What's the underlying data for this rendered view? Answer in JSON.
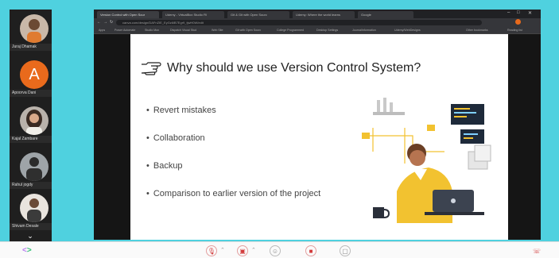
{
  "participants": [
    {
      "name": "Juraj Dhamak",
      "initial": ""
    },
    {
      "name": "Apoorva Dani",
      "initial": "A"
    },
    {
      "name": "Kajal Zambare",
      "initial": ""
    },
    {
      "name": "Rahul jogdy",
      "initial": ""
    },
    {
      "name": "Shivam Desale",
      "initial": ""
    }
  ],
  "browser": {
    "tabs": [
      "Version Control with Open Sour",
      "Udemy - VirtualBox Studio Fil",
      "Git & Git with Open Sourc",
      "Udemy: Where the world learns",
      "Google"
    ],
    "address": "canva.com/design/DAFnZIE_EyGz6iB7Egr9_tjwH0W/edit",
    "bookmarks": [
      "Apps",
      "Power Automate",
      "Studio Mon",
      "Dispatch Visual Stud",
      "Web Site",
      "Git with Open Sourc",
      "College Programmed",
      "Desktop Settings",
      "JournalInformation",
      "Udemy/WebDesigns",
      "Other bookmarks",
      "Reading list"
    ]
  },
  "slide": {
    "title": "Why should we use Version Control System?",
    "bullets": [
      "Revert mistakes",
      "Collaboration",
      "Backup",
      "Comparison to earlier version of the project"
    ]
  },
  "colors": {
    "frame": "#4fd1df",
    "sidebar": "#1f1f1f",
    "avatar_orange": "#e96a1c",
    "shirt_yellow": "#f2c230",
    "end_call_red": "#d23b3b"
  },
  "icons": {
    "pointing_hand": "pointing-hand-icon",
    "mic": "mic-muted-icon",
    "camera": "camera-muted-icon",
    "emoji": "emoji-icon",
    "record": "record-icon",
    "share": "screen-share-icon",
    "end_call": "end-call-icon",
    "code_pager": "code-brackets-icon",
    "expand": "chevron-down-icon"
  }
}
